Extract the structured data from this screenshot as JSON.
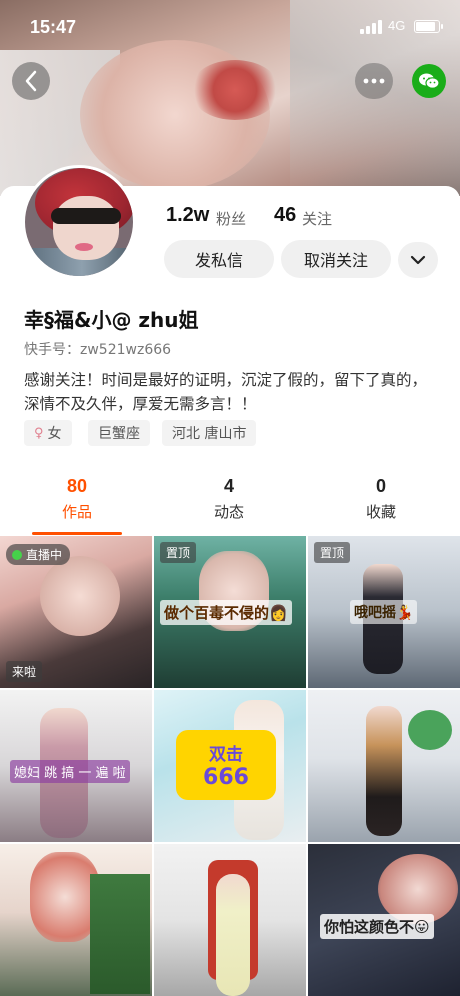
{
  "status": {
    "time": "15:47",
    "network": "4G",
    "battery_level": 0.9
  },
  "header": {
    "back_icon": "chevron-left-icon",
    "more_icon": "ellipsis-icon",
    "share_icon": "wechat-icon"
  },
  "profile": {
    "followers_count": "1.2w",
    "followers_label": "粉丝",
    "following_count": "46",
    "following_label": "关注",
    "message_button": "发私信",
    "unfollow_button": "取消关注",
    "name": "幸§福&小@ zhu姐",
    "kwai_id": "快手号：zw521wz666",
    "bio": "感谢关注！时间是最好的证明，沉淀了假的，留下了真的，深情不及久伴，厚爱无需多言！！",
    "tags": [
      {
        "icon": "female-icon",
        "label": "女"
      },
      {
        "label": "巨蟹座"
      },
      {
        "label": "河北 唐山市"
      }
    ]
  },
  "tabs": [
    {
      "count": "80",
      "label": "作品",
      "active": true
    },
    {
      "count": "4",
      "label": "动态",
      "active": false
    },
    {
      "count": "0",
      "label": "收藏",
      "active": false
    }
  ],
  "grid": {
    "live_label": "直播中",
    "pinned_label": "置顶",
    "items": [
      {
        "badge_bottom": "来啦"
      },
      {
        "caption": "做个百毒不侵的👩"
      },
      {
        "caption": "哦吧摇💃"
      },
      {
        "caption": "媳妇 跳 搞 一 遍 啦"
      },
      {
        "sticker_top": "双击",
        "sticker_bottom": "666"
      },
      {},
      {},
      {},
      {
        "caption": "你怕这颜色不😛"
      }
    ]
  },
  "colors": {
    "accent": "#ff5000",
    "wechat": "#1aad19",
    "live_dot": "#45d24a"
  }
}
